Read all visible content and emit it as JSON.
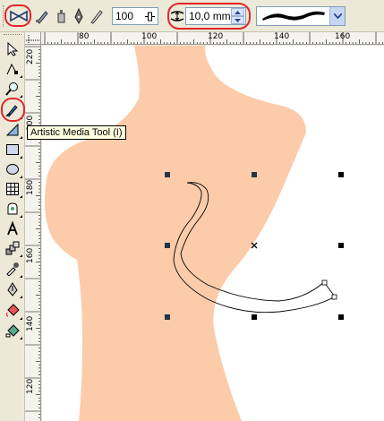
{
  "property_bar": {
    "buttons": [
      {
        "name": "preset-mode-icon",
        "label": "Preset"
      },
      {
        "name": "brush-mode-icon",
        "label": "Brush"
      },
      {
        "name": "sprayer-mode-icon",
        "label": "Sprayer"
      },
      {
        "name": "calligraphic-mode-icon",
        "label": "Calligraphic"
      },
      {
        "name": "pressure-mode-icon",
        "label": "Pressure"
      }
    ],
    "smoothing_value": "100",
    "width_value": "10,0 mm"
  },
  "rulers": {
    "horizontal_labels": [
      "80",
      "100",
      "120",
      "140",
      "160"
    ],
    "vertical_labels": [
      "220",
      "200",
      "180",
      "160",
      "140",
      "120"
    ]
  },
  "toolbox": {
    "active_tool_tooltip": "Artistic Media Tool (I)"
  },
  "colors": {
    "body_shape": "#fccbaa",
    "highlight": "#e0262a",
    "selection_handle": "#000000",
    "dark_handle": "#243447"
  }
}
